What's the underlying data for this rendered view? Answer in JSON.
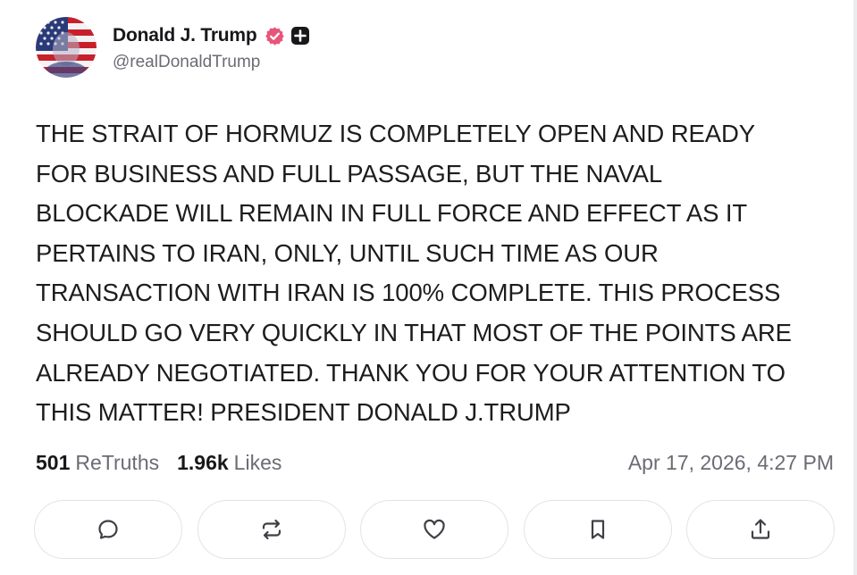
{
  "author": {
    "display_name": "Donald J. Trump",
    "handle": "@realDonaldTrump",
    "avatar_icon": "avatar-flag-portrait",
    "verified_icon": "verified-badge-icon",
    "badge_icon": "plus-badge-icon",
    "verified_color": "#e8557a"
  },
  "post": {
    "text": "THE STRAIT OF HORMUZ IS COMPLETELY OPEN AND READY\nFOR BUSINESS AND FULL PASSAGE, BUT THE NAVAL\nBLOCKADE WILL REMAIN IN FULL FORCE AND EFFECT AS IT\nPERTAINS TO IRAN, ONLY, UNTIL SUCH TIME AS OUR\nTRANSACTION WITH IRAN IS 100% COMPLETE. THIS PROCESS\nSHOULD GO VERY QUICKLY IN THAT MOST OF THE POINTS ARE\nALREADY NEGOTIATED. THANK YOU FOR YOUR ATTENTION TO\nTHIS MATTER! PRESIDENT DONALD J.TRUMP"
  },
  "stats": {
    "retruths_count": "501",
    "retruths_label": "ReTruths",
    "likes_count": "1.96k",
    "likes_label": "Likes",
    "timestamp": "Apr 17, 2026, 4:27 PM"
  },
  "actions": [
    {
      "icon": "reply-icon"
    },
    {
      "icon": "retruth-icon"
    },
    {
      "icon": "heart-icon"
    },
    {
      "icon": "bookmark-icon"
    },
    {
      "icon": "share-icon"
    }
  ]
}
